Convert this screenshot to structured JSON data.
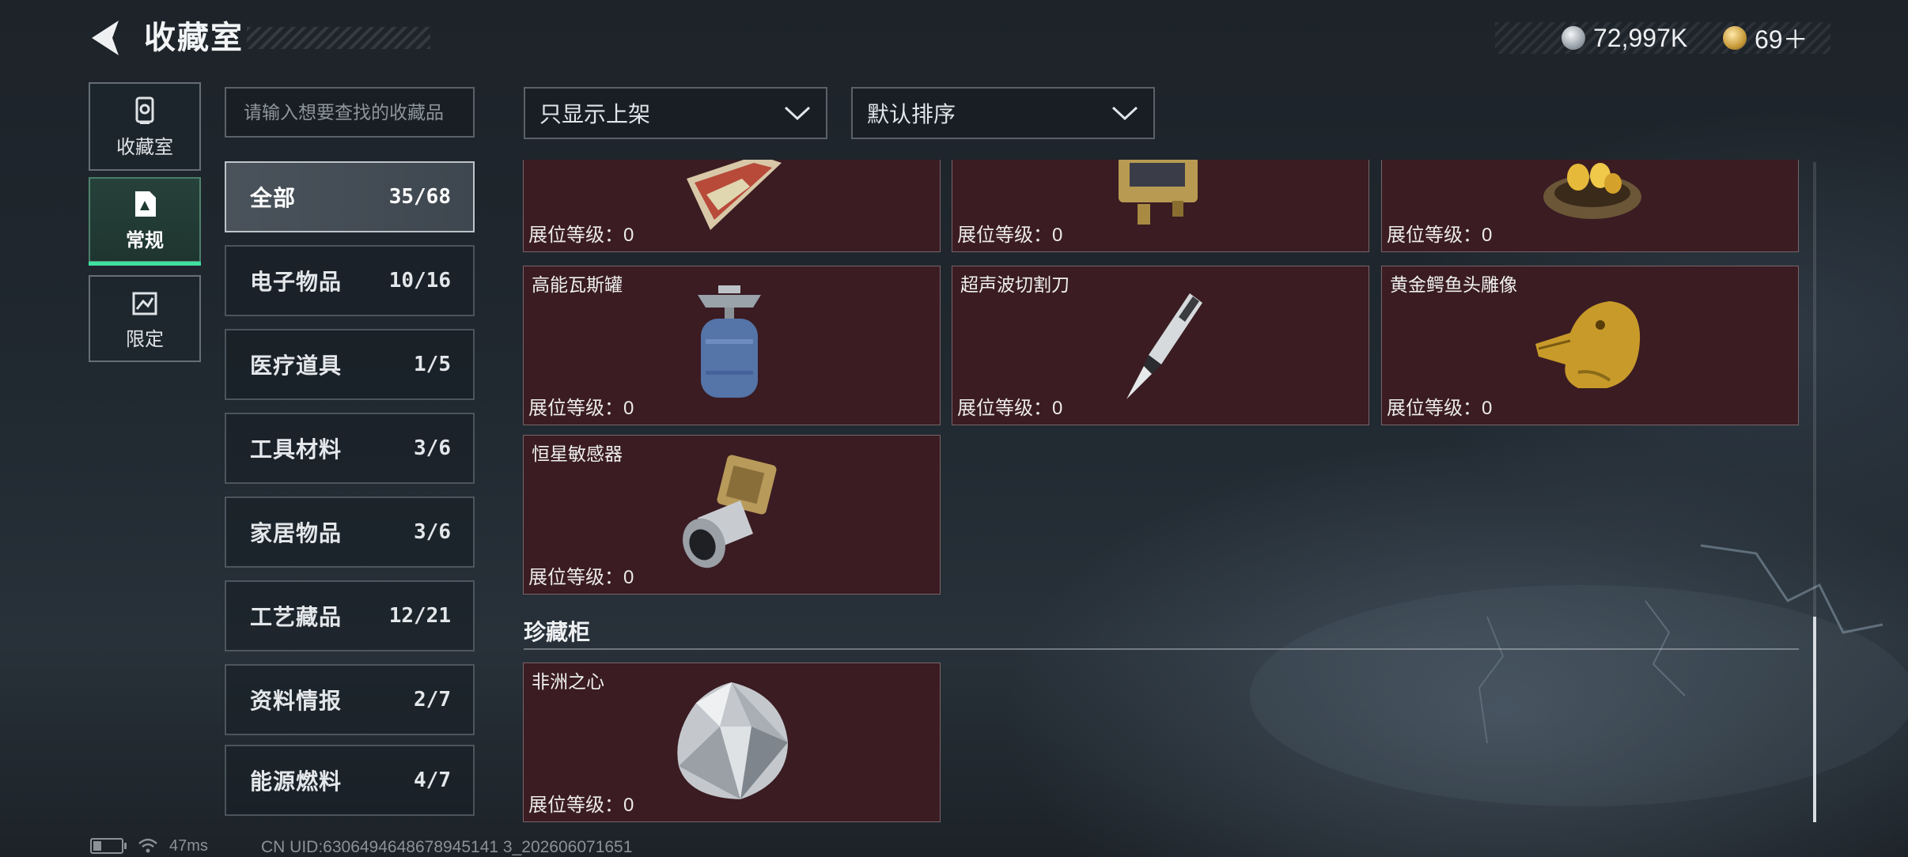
{
  "header": {
    "title": "收藏室",
    "currency_silver": "72,997K",
    "currency_gold": "69＋"
  },
  "rail": [
    {
      "label": "收藏室",
      "icon": "collection-room-icon"
    },
    {
      "label": "常规",
      "icon": "regular-collection-icon",
      "active": true
    },
    {
      "label": "限定",
      "icon": "limited-collection-icon"
    }
  ],
  "search": {
    "placeholder": "请输入想要查找的收藏品"
  },
  "filters": {
    "display": "只显示上架",
    "sort": "默认排序"
  },
  "categories": [
    {
      "name": "全部",
      "count": "35/68",
      "active": true
    },
    {
      "name": "电子物品",
      "count": "10/16"
    },
    {
      "name": "医疗道具",
      "count": "1/5"
    },
    {
      "name": "工具材料",
      "count": "3/6"
    },
    {
      "name": "家居物品",
      "count": "3/6"
    },
    {
      "name": "工艺藏品",
      "count": "12/21"
    },
    {
      "name": "资料情报",
      "count": "2/7"
    },
    {
      "name": "能源燃料",
      "count": "4/7"
    }
  ],
  "items_top_partial": [
    {
      "level": "展位等级：0",
      "icon": "painted-card-icon"
    },
    {
      "level": "展位等级：0",
      "icon": "gold-device-icon"
    },
    {
      "level": "展位等级：0",
      "icon": "golden-egg-nest-icon"
    }
  ],
  "items": [
    {
      "name": "高能瓦斯罐",
      "level": "展位等级：0",
      "icon": "gas-canister-icon"
    },
    {
      "name": "超声波切割刀",
      "level": "展位等级：0",
      "icon": "ultrasonic-cutter-icon"
    },
    {
      "name": "黄金鳄鱼头雕像",
      "level": "展位等级：0",
      "icon": "golden-crocodile-statue-icon"
    },
    {
      "name": "恒星敏感器",
      "level": "展位等级：0",
      "icon": "star-sensor-icon"
    }
  ],
  "vault_section": {
    "title": "珍藏柜",
    "items": [
      {
        "name": "非洲之心",
        "level": "展位等级：0",
        "icon": "diamond-icon"
      }
    ]
  },
  "footer": {
    "ping": "47ms",
    "uid": "CN UID:6306494648678945141 3_202606071651"
  },
  "colors": {
    "card_bg": "#3a1c22",
    "active_accent": "#3fe0a0"
  }
}
